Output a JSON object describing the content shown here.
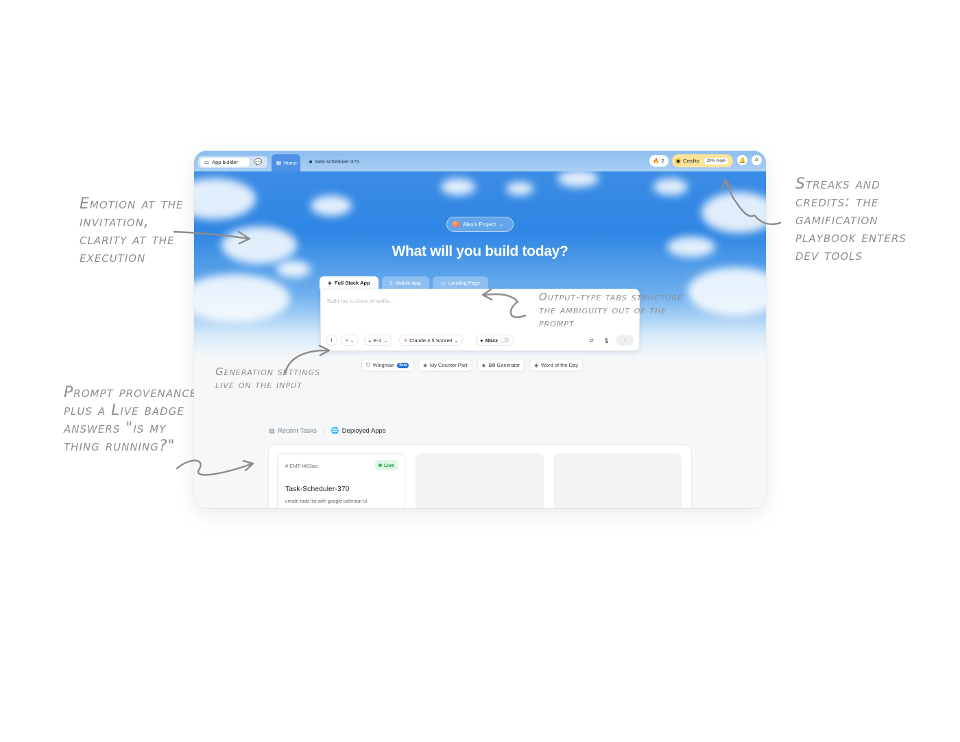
{
  "annotations": {
    "emotion": "Emotion at the invitation, clarity at the execution",
    "streaks": "Streaks and credits: the gamification playbook enters dev tools",
    "tabs": "Output-type tabs structure the ambiguity out of the prompt",
    "generation": "Generation settings live on the input",
    "provenance": "Prompt provenance plus a Live badge answers \"is my thing running?\""
  },
  "topbar": {
    "app_builder": "App builder",
    "home_tab": "Home",
    "task_tab": "task-scheduler-370",
    "streak_count": "2",
    "credits_label": "Credits",
    "credits_badge": "20% more",
    "avatar_letter": "A"
  },
  "hero": {
    "project": "Alex's Project",
    "title": "What will you build today?"
  },
  "output_tabs": [
    {
      "label": "Full Stack App",
      "icon": "layers-icon",
      "active": true
    },
    {
      "label": "Mobile App",
      "icon": "phone-icon",
      "active": false
    },
    {
      "label": "Landing Page",
      "icon": "browser-icon",
      "active": false
    }
  ],
  "prompt": {
    "placeholder": "Build me a clone of netflix...",
    "agent": "E-1",
    "model": "Claude 4.5 Sonnet",
    "mode": "Maxx"
  },
  "suggestions": [
    {
      "label": "Wingman",
      "badge": "Beta"
    },
    {
      "label": "My Counter Part"
    },
    {
      "label": "Bill Generator"
    },
    {
      "label": "Word of the Day"
    }
  ],
  "bottom_tabs": {
    "recent": "Recent Tasks",
    "deployed": "Deployed Apps"
  },
  "cards": [
    {
      "id": "# EMT-f463aa",
      "status": "Live",
      "title": "Task-Scheduler-370",
      "desc": "create todo list with google calendar ui"
    }
  ],
  "colors": {
    "sky": "#2f86e3",
    "live_green": "#1f9a4c",
    "credits_yellow": "#fbe39a",
    "annotation_gray": "#8d8d8d"
  }
}
